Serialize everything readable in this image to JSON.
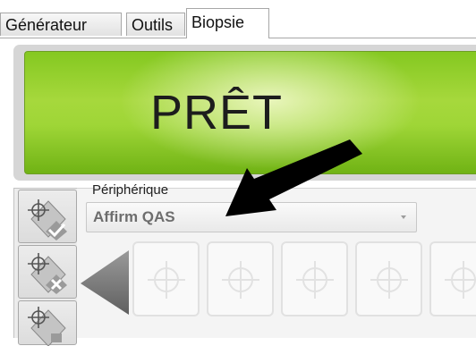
{
  "tabs": [
    {
      "label": "Générateur",
      "active": false
    },
    {
      "label": "Outils",
      "active": false
    },
    {
      "label": "Biopsie",
      "active": true
    }
  ],
  "status": {
    "text": "PRÊT",
    "color": "#9fd637"
  },
  "device": {
    "label": "Périphérique",
    "selected": "Affirm QAS"
  },
  "side_buttons": [
    {
      "icon": "crosshair-check-icon"
    },
    {
      "icon": "crosshair-x-icon"
    },
    {
      "icon": "crosshair-icon"
    }
  ],
  "targets": {
    "nav_icon": "triangle-left-icon",
    "cells": [
      {
        "icon": "crosshair-icon"
      },
      {
        "icon": "crosshair-icon"
      },
      {
        "icon": "crosshair-icon"
      },
      {
        "icon": "crosshair-icon"
      },
      {
        "icon": "crosshair-icon"
      }
    ]
  },
  "annotation": {
    "icon": "pointer-arrow-icon",
    "color": "#000000"
  }
}
